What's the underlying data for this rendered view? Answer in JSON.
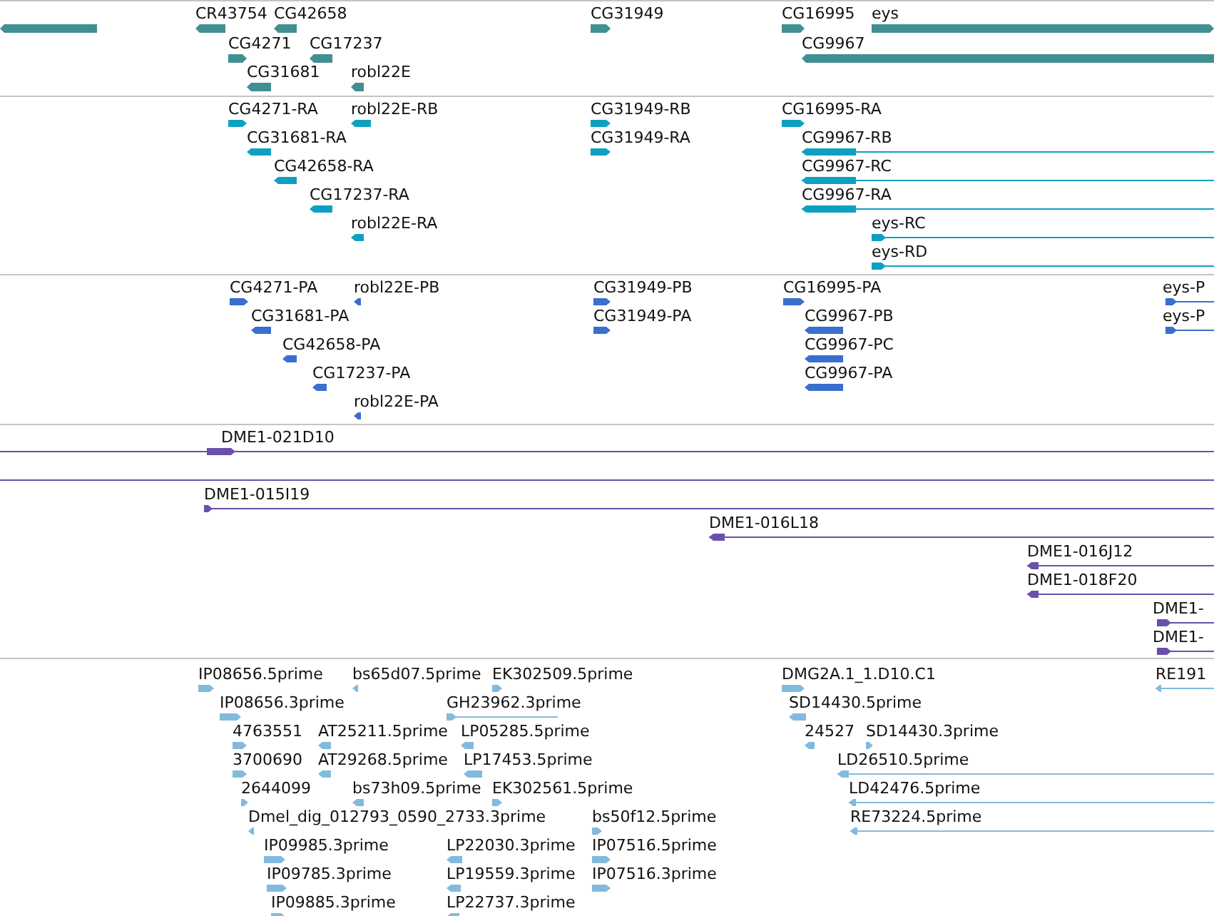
{
  "tracks": [
    {
      "color": "#418f92",
      "features": [
        {
          "kind": "block",
          "reverse": true
        },
        {
          "kind": "block",
          "label": "CR43754",
          "reverse": true
        },
        {
          "kind": "block",
          "label": "CG42658",
          "reverse": true
        },
        {
          "kind": "block",
          "label": "CG31949",
          "reverse": false
        },
        {
          "kind": "block",
          "label": "CG16995",
          "reverse": false
        },
        {
          "kind": "block",
          "label": "eys",
          "reverse": false
        },
        {
          "kind": "block",
          "label": "CG4271",
          "reverse": false
        },
        {
          "kind": "block",
          "label": "CG17237",
          "reverse": true
        },
        {
          "kind": "block",
          "label": "CG9967",
          "reverse": true
        },
        {
          "kind": "block",
          "label": "CG31681",
          "reverse": true
        },
        {
          "kind": "block",
          "label": "robl22E",
          "reverse": true
        }
      ]
    },
    {
      "color": "#0ea0c0",
      "features": [
        {
          "kind": "block",
          "label": "CG4271-RA",
          "reverse": false
        },
        {
          "kind": "block",
          "label": "robl22E-RB",
          "reverse": true
        },
        {
          "kind": "block",
          "label": "CG31949-RB",
          "reverse": false
        },
        {
          "kind": "block",
          "label": "CG16995-RA",
          "reverse": false
        },
        {
          "kind": "block",
          "label": "CG31681-RA",
          "reverse": true
        },
        {
          "kind": "block",
          "label": "CG31949-RA",
          "reverse": false
        },
        {
          "kind": "block",
          "label": "CG9967-RB",
          "reverse": true
        },
        {
          "kind": "block",
          "label": "CG42658-RA",
          "reverse": true
        },
        {
          "kind": "block",
          "label": "CG9967-RC",
          "reverse": true
        },
        {
          "kind": "block",
          "label": "CG17237-RA",
          "reverse": true
        },
        {
          "kind": "block",
          "label": "CG9967-RA",
          "reverse": true
        },
        {
          "kind": "block",
          "label": "robl22E-RA",
          "reverse": true
        },
        {
          "kind": "block",
          "label": "eys-RC",
          "reverse": false
        },
        {
          "kind": "block",
          "label": "eys-RD",
          "reverse": false
        }
      ]
    },
    {
      "color": "#3a6ecf",
      "features": [
        {
          "kind": "block",
          "label": "CG4271-PA",
          "reverse": false
        },
        {
          "kind": "block",
          "label": "robl22E-PB",
          "reverse": true
        },
        {
          "kind": "block",
          "label": "CG31949-PB",
          "reverse": false
        },
        {
          "kind": "block",
          "label": "CG16995-PA",
          "reverse": false
        },
        {
          "kind": "block",
          "label": "eys-P",
          "reverse": false
        },
        {
          "kind": "block",
          "label": "CG31681-PA",
          "reverse": true
        },
        {
          "kind": "block",
          "label": "CG31949-PA",
          "reverse": false
        },
        {
          "kind": "block",
          "label": "CG9967-PB",
          "reverse": true
        },
        {
          "kind": "block",
          "label": "eys-P",
          "reverse": false
        },
        {
          "kind": "block",
          "label": "CG42658-PA",
          "reverse": true
        },
        {
          "kind": "block",
          "label": "CG9967-PC",
          "reverse": true
        },
        {
          "kind": "block",
          "label": "CG17237-PA",
          "reverse": true
        },
        {
          "kind": "block",
          "label": "CG9967-PA",
          "reverse": true
        },
        {
          "kind": "block",
          "label": "robl22E-PA",
          "reverse": true
        }
      ]
    },
    {
      "color": "#6a50aa",
      "features": [
        {
          "kind": "block",
          "label": "DME1-021D10",
          "reverse": false
        },
        {
          "kind": "line"
        },
        {
          "kind": "block",
          "label": "DME1-015I19",
          "reverse": false
        },
        {
          "kind": "block",
          "label": "DME1-016L18",
          "reverse": true
        },
        {
          "kind": "block",
          "label": "DME1-016J12",
          "reverse": true
        },
        {
          "kind": "block",
          "label": "DME1-018F20",
          "reverse": true
        },
        {
          "kind": "block",
          "label": "DME1-",
          "reverse": false
        },
        {
          "kind": "block",
          "label": "DME1-",
          "reverse": false
        }
      ]
    },
    {
      "color": "#82bade",
      "features": [
        {
          "kind": "block",
          "label": "IP08656.5prime",
          "reverse": false
        },
        {
          "kind": "block",
          "label": "bs65d07.5prime",
          "reverse": true
        },
        {
          "kind": "block",
          "label": "EK302509.5prime",
          "reverse": false
        },
        {
          "kind": "block",
          "label": "DMG2A.1_1.D10.C1",
          "reverse": false
        },
        {
          "kind": "block",
          "label": "RE191",
          "reverse": true
        },
        {
          "kind": "block",
          "label": "IP08656.3prime",
          "reverse": false
        },
        {
          "kind": "block",
          "label": "GH23962.3prime",
          "reverse": false
        },
        {
          "kind": "block",
          "label": "SD14430.5prime",
          "reverse": true
        },
        {
          "kind": "block",
          "label": "4763551",
          "reverse": false
        },
        {
          "kind": "block",
          "label": "AT25211.5prime",
          "reverse": true
        },
        {
          "kind": "block",
          "label": "LP05285.5prime",
          "reverse": true
        },
        {
          "kind": "block",
          "label": "24527",
          "reverse": true
        },
        {
          "kind": "block",
          "label": "SD14430.3prime",
          "reverse": false
        },
        {
          "kind": "block",
          "label": "3700690",
          "reverse": false
        },
        {
          "kind": "block",
          "label": "AT29268.5prime",
          "reverse": true
        },
        {
          "kind": "block",
          "label": "LP17453.5prime",
          "reverse": true
        },
        {
          "kind": "block",
          "label": "LD26510.5prime",
          "reverse": true
        },
        {
          "kind": "block",
          "label": "2644099",
          "reverse": false
        },
        {
          "kind": "block",
          "label": "bs73h09.5prime",
          "reverse": true
        },
        {
          "kind": "block",
          "label": "EK302561.5prime",
          "reverse": false
        },
        {
          "kind": "block",
          "label": "LD42476.5prime",
          "reverse": true
        },
        {
          "kind": "block",
          "label": "Dmel_dig_012793_0590_2733.3prime",
          "reverse": true
        },
        {
          "kind": "block",
          "label": "bs50f12.5prime",
          "reverse": false
        },
        {
          "kind": "block",
          "label": "RE73224.5prime",
          "reverse": true
        },
        {
          "kind": "block",
          "label": "IP09985.3prime",
          "reverse": false
        },
        {
          "kind": "block",
          "label": "LP22030.3prime",
          "reverse": true
        },
        {
          "kind": "block",
          "label": "IP07516.5prime",
          "reverse": false
        },
        {
          "kind": "block",
          "label": "IP09785.3prime",
          "reverse": false
        },
        {
          "kind": "block",
          "label": "LP19559.3prime",
          "reverse": true
        },
        {
          "kind": "block",
          "label": "IP07516.3prime",
          "reverse": false
        },
        {
          "kind": "block",
          "label": "IP09885.3prime",
          "reverse": false
        },
        {
          "kind": "block",
          "label": "LP22737.3prime",
          "reverse": true
        }
      ]
    }
  ]
}
